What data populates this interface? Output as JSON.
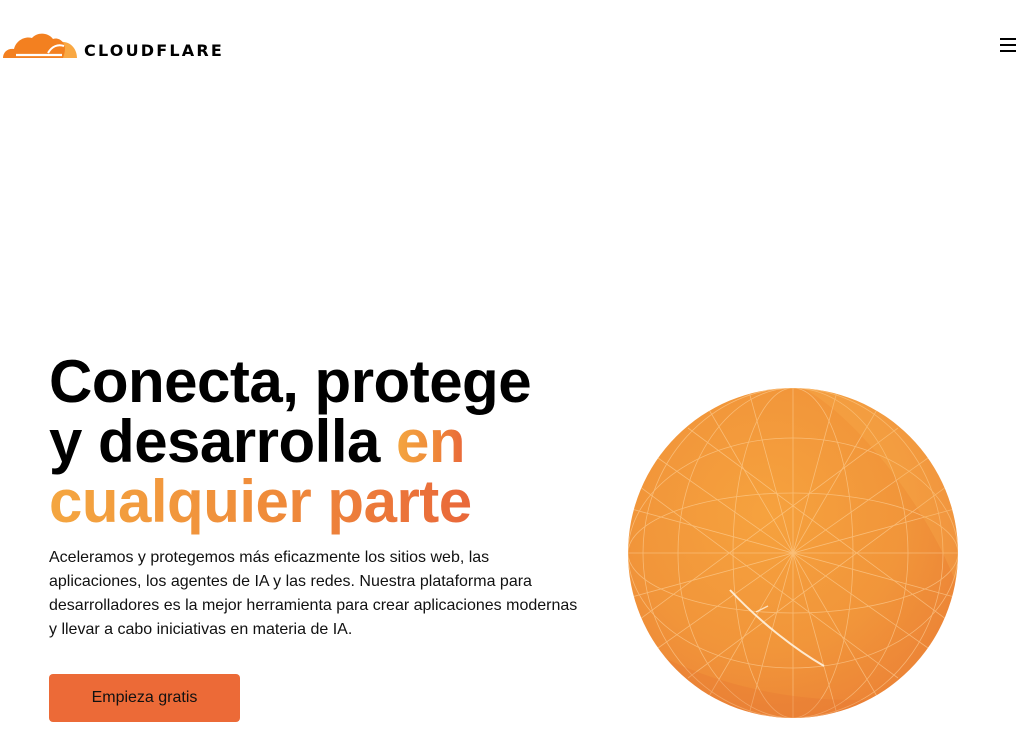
{
  "brand": {
    "name": "CLOUDFLARE",
    "logo_icon": "cloud-logo-icon",
    "accent_color": "#F38020"
  },
  "header": {
    "menu_icon": "hamburger-menu-icon"
  },
  "hero": {
    "title_line1": "Conecta, protege",
    "title_line2_plain": "y desarrolla ",
    "title_line2_accent": "en",
    "title_line3_accent": "cualquier parte",
    "description": "Aceleramos y protegemos más eficazmente los sitios web, las aplicaciones, los agentes de IA y las redes. Nuestra plataforma para desarrolladores es la mejor herramienta para crear aplicaciones modernas y llevar a cabo iniciativas en materia de IA.",
    "cta_label": "Empieza gratis",
    "cta_color": "#EC6A37",
    "globe_icon": "globe-network-icon"
  }
}
